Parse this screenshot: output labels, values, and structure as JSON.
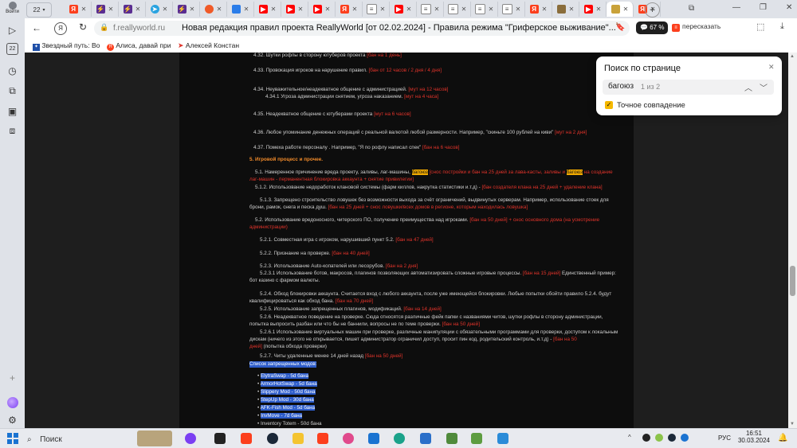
{
  "sidebar": {
    "profile_label": "Войти",
    "badge_count": "22"
  },
  "tabs": {
    "counter": "22"
  },
  "address": {
    "domain": "f.reallyworld.ru",
    "title": "Новая редакция правил проекта ReallyWorld [от 02.02.2024] - Правила режима \"Гриферское выживание\"...",
    "chat_badge": "67 %",
    "retell_label": "пересказать"
  },
  "bookmarks": [
    {
      "label": "Звездный путь: Во"
    },
    {
      "label": "Алиса, давай при"
    },
    {
      "label": "Алексей Констан"
    }
  ],
  "find": {
    "title": "Поиск по странице",
    "query": "багоюз",
    "count": "1 из 2",
    "exact_label": "Точное совпадение",
    "exact_checked": true
  },
  "rules": {
    "r4_32": "4.32. Шутки рофлы в сторону ютуберов проекта",
    "r4_32p": "[бан на 1 день]",
    "r4_33": "4.33. Провокация игроков на нарушение правил.",
    "r4_33p": "[бан от 12 часов / 2 дня / 4 дня]",
    "r4_34": "4.34. Неуважительное/неадекватное общение с администрацией.",
    "r4_34p": "[мут на 12 часов]",
    "r4_34_1": "4.34.1 Угроза администрации снятием, угроза наказанием.",
    "r4_34_1p": "[мут на 4 часа]",
    "r4_35": "4.35. Неадекватное общение с ютуберами проекта",
    "r4_35p": "[мут на 6 часов]",
    "r4_36": "4.36. Любое упоминание денежных операций с реальной валютой любой размерности. Например, \"скиньте 100 рублей на киви\"",
    "r4_36p": "[мут на 2 дня]",
    "r4_37": "4.37. Помеха работе персоналу . Например, \"Я по рофлу написал спек\"",
    "r4_37p": "[бан на 6 часов]",
    "s5": "5. Игровой процесс и прочее.",
    "r5_1a": "5.1. Намеренное причинение вреда проекту, заливы, лаг-машины,",
    "r5_1hl1": "багоюз",
    "r5_1b": "[снос постройки и бан на 25 дней за лава-касты, заливы и",
    "r5_1hl2": "багоюз",
    "r5_1c": "на создание",
    "r5_1d": "лаг-машин - перманентная блокировка аккаунта + снятие привилегии]",
    "r5_1_2": "5.1.2. Использование недоработок клановой системы (фарм киллов, накрутка статистики и.т.д) -",
    "r5_1_2p": "[бан создателя клана на 25 дней + удаление клана]",
    "r5_1_3a": "5.1.3. Запрещено строительство ловушек без возможности выхода за счёт ограничений, выдвинутых серверам. Например, использование стоек для",
    "r5_1_3b": "брони, рамок, снега и песка душ.",
    "r5_1_3p": "[бан на 25 дней + снос ловушки/всех домов в регионе, которым находилась ловушка]",
    "r5_2": "5.2. Использование вредоносного, читерского ПО, получение преимущества над игроками.",
    "r5_2p": "[бан на 50 дней] + снос основного дома (на усмотрение",
    "r5_2p2": "администрации)",
    "r5_2_1": "5.2.1. Совместная игра с игроком, нарушивший пункт 5.2.",
    "r5_2_1p": "[бан на 47 дней]",
    "r5_2_2": "5.2.2. Признание на проверке.",
    "r5_2_2p": "[бан на 40 дней]",
    "r5_2_3": "5.2.3. Использование Auto-копателей или лесорубов.",
    "r5_2_3p": "[бан на 2 дня]",
    "r5_2_3_1": "5.2.3.1 Использование ботов, макросов, плагинов позволяющих автоматизировать сложные игровые процессы.",
    "r5_2_3_1p": "[бан на 15 дней]",
    "r5_2_3_1t": "Единственный пример:",
    "r5_2_3_1u": "бот казино с фармом валюты.",
    "r5_2_4a": "5.2.4. Обход блокировки аккаунта. Считается вход с любого аккаунта, после уже имеющейся блокировки. Любые попытки обойти правило 5.2.4. будут",
    "r5_2_4b": "квалифицироваться как обход бана.",
    "r5_2_4p": "[бан на 70 дней]",
    "r5_2_5": "5.2.5. Использование запрещенных плагинов, модификаций.",
    "r5_2_5p": "[бан на 14 дней]",
    "r5_2_6a": "5.2.6. Неадекватное поведение на проверке. Сюда относятся различные фейк папки с названиями читов, шутки рофлы в сторону администрации,",
    "r5_2_6b": "попытка выпросить разбан или что бы не баннили, вопросы не по теме проверки.",
    "r5_2_6p": "[бан на 50 дней]",
    "r5_2_6_1a": "5.2.6.1 Использование виртуальных машин при проверке, различные манипуляции с обязательными программами для проверки, доступом к локальным",
    "r5_2_6_1b": "дискам (ничего из этого не открывается, пишет администратор ограничил доступ, просит пин код, родительский контроль, и.т.д) -",
    "r5_2_6_1p": "[бан на 50",
    "r5_2_6_1p2": "дней]",
    "r5_2_6_1t": "(попытка обхода проверки)",
    "r5_2_7": "5.2.7. Читы удаленные менее 14 дней назад",
    "r5_2_7p": "[бан на 50 дней]",
    "mods_title": "Список запрещенных модов:",
    "mods": [
      "ElytraSwap - 5d бана",
      "ArmorHotSwap - 5d бана",
      "Slippery Mod - 50d бана",
      "StepUp Mod - 30d бана",
      "AFK-Fish Mod - 5d бана",
      "InvMove - 7d бана",
      "Inventory Totem - 50d бана"
    ]
  },
  "taskbar": {
    "search_label": "Поиск",
    "lang": "РУС",
    "time": "16:51",
    "date": "30.03.2024"
  }
}
